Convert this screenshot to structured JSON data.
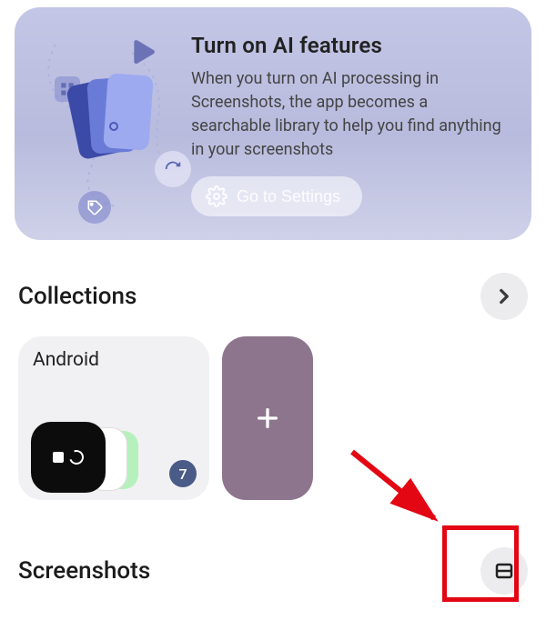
{
  "promo": {
    "title": "Turn on AI features",
    "body": "When you turn on AI processing in Screenshots, the app becomes a searchable library to help you find anything in your screenshots",
    "cta_label": "Go to Settings"
  },
  "collections": {
    "header": "Collections",
    "items": [
      {
        "name": "Android",
        "count": "7"
      }
    ]
  },
  "screenshots": {
    "header": "Screenshots"
  }
}
